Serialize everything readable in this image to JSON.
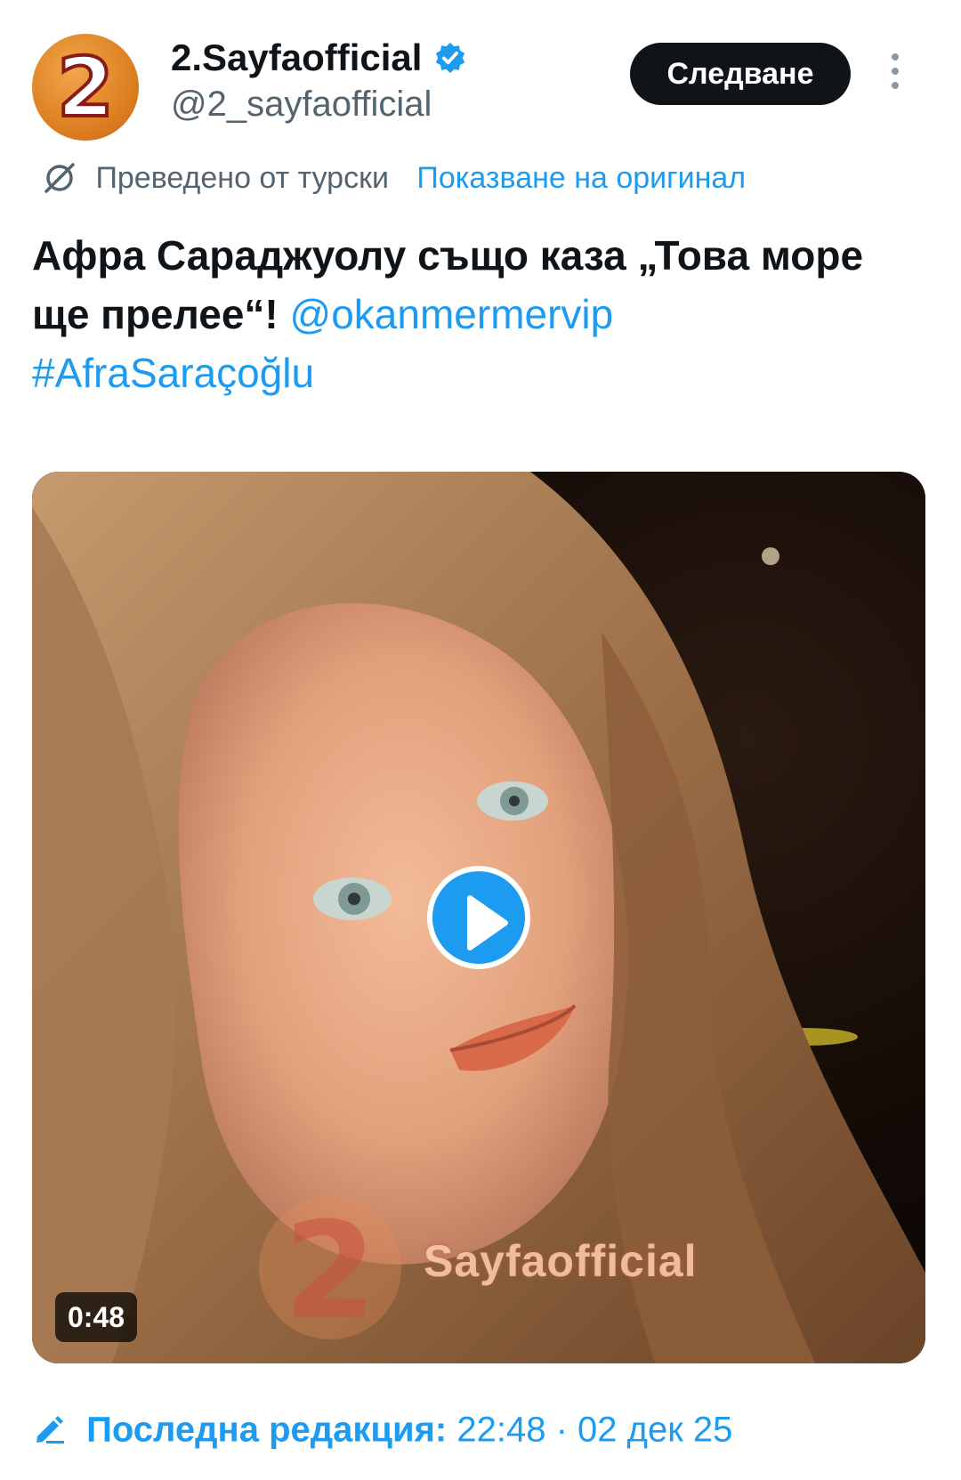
{
  "account": {
    "avatar_logo_text": "2",
    "display_name": "2.Sayfaofficial",
    "handle": "@2_sayfaofficial",
    "verified": true
  },
  "follow_label": "Следване",
  "translation": {
    "translated_from": "Преведено от турски",
    "show_original": "Показване на оригинал"
  },
  "tweet": {
    "text": "Афра Сараджуолу също каза „Това море ще прелее“! ",
    "mention": "@okanmermervip",
    "hashtag": "#AfraSaraçoğlu"
  },
  "media": {
    "duration": "0:48",
    "watermark": "Sayfaofficial",
    "watermark_logo": "2"
  },
  "edit": {
    "label": "Последна редакция:",
    "time": "22:48 · 02 дек 25"
  },
  "colors": {
    "accent": "#1d9bf0",
    "text": "#0f1419",
    "secondary": "#536471",
    "follow_bg": "#0f1419"
  },
  "icons": {
    "verified": "verified-badge-icon",
    "more": "more-options-icon",
    "translate": "translate-icon",
    "play": "play-icon",
    "edit": "edit-pencil-icon"
  }
}
